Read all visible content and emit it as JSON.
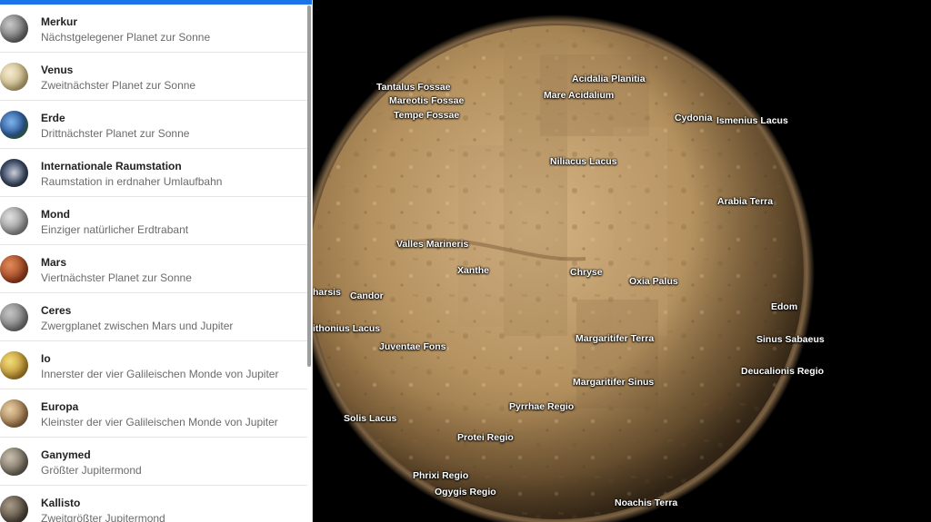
{
  "list": [
    {
      "name": "Merkur",
      "desc": "Nächstgelegener Planet zur Sonne",
      "color": "#8a8a8a"
    },
    {
      "name": "Venus",
      "desc": "Zweitnächster Planet zur Sonne",
      "color": "#d9c9a0"
    },
    {
      "name": "Erde",
      "desc": "Drittnächster Planet zur Sonne",
      "color": "#3b6fb0"
    },
    {
      "name": "Internationale Raumstation",
      "desc": "Raumstation in erdnaher Umlaufbahn",
      "color": "#3a4660"
    },
    {
      "name": "Mond",
      "desc": "Einziger natürlicher Erdtrabant",
      "color": "#a9a9a9"
    },
    {
      "name": "Mars",
      "desc": "Viertnächster Planet zur Sonne",
      "color": "#b5542d"
    },
    {
      "name": "Ceres",
      "desc": "Zwergplanet zwischen Mars und Jupiter",
      "color": "#8c8c8c"
    },
    {
      "name": "Io",
      "desc": "Innerster der vier Galileischen Monde von Jupiter",
      "color": "#c9a63a"
    },
    {
      "name": "Europa",
      "desc": "Kleinster der vier Galileischen Monde von Jupiter",
      "color": "#b08a5e"
    },
    {
      "name": "Ganymed",
      "desc": "Größter Jupitermond",
      "color": "#8a8070"
    },
    {
      "name": "Kallisto",
      "desc": "Zweitgrößter Jupitermond",
      "color": "#6d6256"
    }
  ],
  "map_labels": [
    "Tantalus Fossae",
    "Mareotis Fossae",
    "Tempe Fossae",
    "Acidalia Planitia",
    "Mare Acidalium",
    "Cydonia",
    "Ismenius Lacus",
    "Niliacus Lacus",
    "Arabia Terra",
    "Valles Marineris",
    "Xanthe",
    "Chryse",
    "Oxia Palus",
    "harsis",
    "Candor",
    "Edom",
    "ithonius Lacus",
    "Juventae Fons",
    "Margaritifer Terra",
    "Sinus Sabaeus",
    "Deucalionis Regio",
    "Margaritifer Sinus",
    "Pyrrhae Regio",
    "Solis Lacus",
    "Protei Regio",
    "Phrixi Regio",
    "Ogygis Regio",
    "Noachis Terra"
  ],
  "colors": {
    "accent": "#1a73e8",
    "planet": "#b08d5c"
  }
}
